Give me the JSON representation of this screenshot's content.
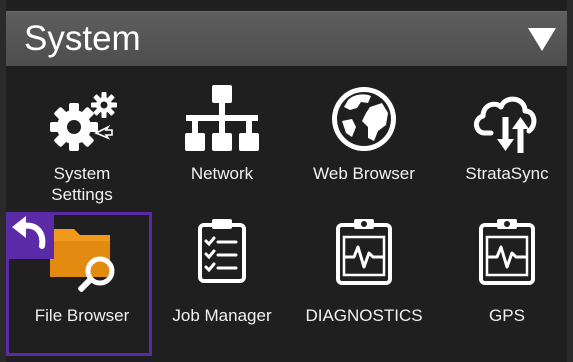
{
  "header": {
    "title": "System"
  },
  "tiles": [
    {
      "line1": "System",
      "line2": "Settings"
    },
    {
      "line1": "Network",
      "line2": ""
    },
    {
      "line1": "Web Browser",
      "line2": ""
    },
    {
      "line1": "StrataSync",
      "line2": ""
    },
    {
      "line1": "File Browser",
      "line2": ""
    },
    {
      "line1": "Job Manager",
      "line2": ""
    },
    {
      "line1": "DIAGNOSTICS",
      "line2": ""
    },
    {
      "line1": "GPS",
      "line2": ""
    }
  ],
  "icons": {
    "tile_1": "gear-icon",
    "tile_2": "network-icon",
    "tile_3": "globe-icon",
    "tile_4": "cloud-sync-icon",
    "tile_5": "folder-search-icon",
    "tile_6": "clipboard-checklist-icon",
    "tile_7": "clipboard-pulse-icon",
    "tile_8": "clipboard-pulse-icon",
    "back": "back-arrow-icon",
    "dropdown": "dropdown-caret-icon"
  },
  "colors": {
    "background": "#1f1f1f",
    "header": "#555555",
    "selection": "#5b2aa7",
    "folder": "#f39a1e",
    "icon": "#ffffff"
  }
}
